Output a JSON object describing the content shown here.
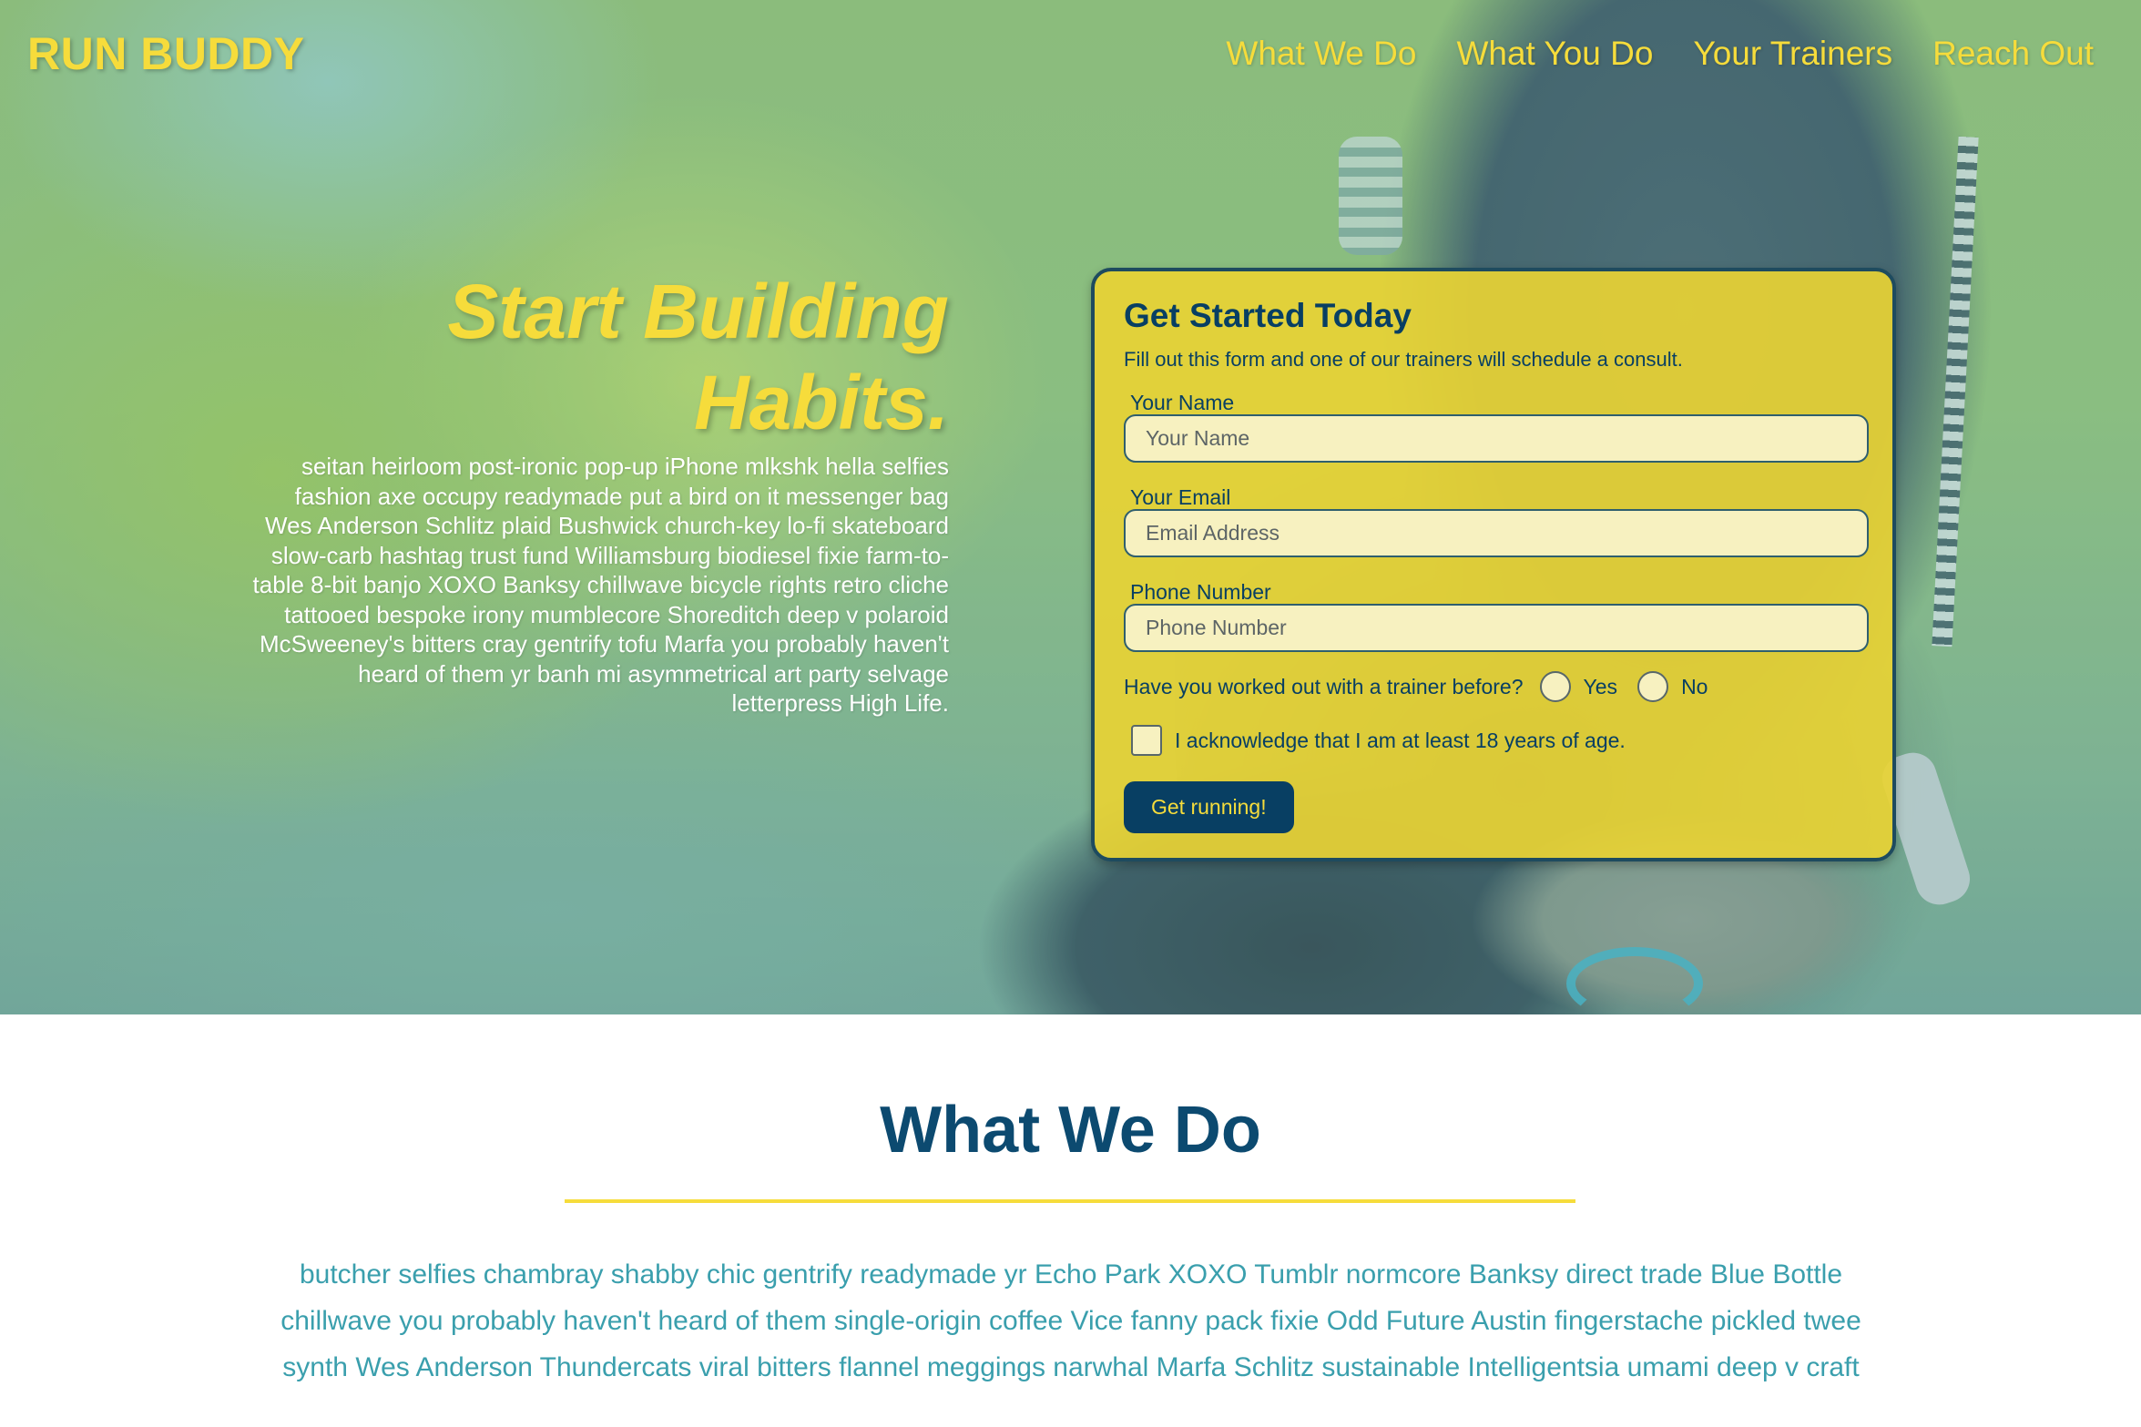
{
  "header": {
    "brand": "RUN BUDDY",
    "nav": [
      "What We Do",
      "What You Do",
      "Your Trainers",
      "Reach Out"
    ]
  },
  "hero": {
    "title_line1": "Start Building",
    "title_line2": "Habits.",
    "body": "seitan heirloom post-ironic pop-up iPhone mlkshk hella selfies fashion axe occupy readymade put a bird on it messenger bag Wes Anderson Schlitz plaid Bushwick church-key lo-fi skateboard slow-carb hashtag trust fund Williamsburg biodiesel fixie farm-to-table 8-bit banjo XOXO Banksy chillwave bicycle rights retro cliche tattooed bespoke irony mumblecore Shoreditch deep v polaroid McSweeney's bitters cray gentrify tofu Marfa you probably haven't heard of them yr banh mi asymmetrical art party selvage letterpress High Life."
  },
  "form": {
    "title": "Get Started Today",
    "subtitle": "Fill out this form and one of our trainers will schedule a consult.",
    "name_label": "Your Name",
    "name_placeholder": "Your Name",
    "email_label": "Your Email",
    "email_placeholder": "Email Address",
    "phone_label": "Phone Number",
    "phone_placeholder": "Phone Number",
    "trainer_question": "Have you worked out with a trainer before?",
    "yes_label": "Yes",
    "no_label": "No",
    "age_ack": "I acknowledge that I am at least 18 years of age.",
    "submit": "Get running!"
  },
  "what_we_do": {
    "title": "What We Do",
    "body": "butcher selfies chambray shabby chic gentrify readymade yr Echo Park XOXO Tumblr normcore Banksy direct trade Blue Bottle chillwave you probably haven't heard of them single-origin coffee Vice fanny pack fixie Odd Future Austin fingerstache pickled twee synth Wes Anderson Thundercats viral bitters flannel meggings narwhal Marfa Schlitz sustainable Intelligentsia umami deep v craft"
  },
  "colors": {
    "accent_yellow": "#f6dc3b",
    "navy": "#083f63",
    "teal_text": "#3a9fad"
  }
}
